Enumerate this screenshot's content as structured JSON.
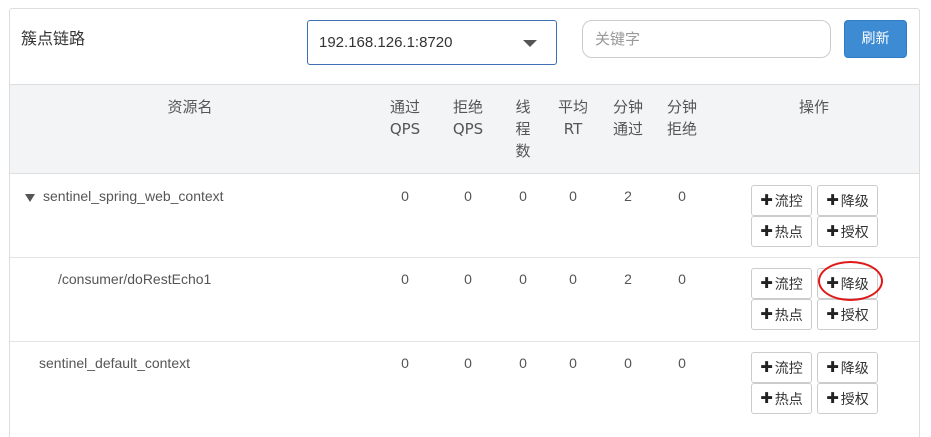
{
  "header": {
    "title": "簇点链路",
    "machine_select_value": "192.168.126.1:8720",
    "search_placeholder": "关键字",
    "refresh_label": "刷新"
  },
  "columns": {
    "resource": "资源名",
    "pass_qps": "通过\nQPS",
    "block_qps": "拒绝\nQPS",
    "threads": "线\n程\n数",
    "avg_rt": "平均\nRT",
    "pass_min": "分钟\n通过",
    "block_min": "分钟\n拒绝",
    "ops": "操作"
  },
  "rows": [
    {
      "name": "sentinel_spring_web_context",
      "expanded": true,
      "pass_qps": "0",
      "block_qps": "0",
      "threads": "0",
      "avg_rt": "0",
      "pass_min": "2",
      "block_min": "0"
    },
    {
      "name": "/consumer/doRestEcho1",
      "pass_qps": "0",
      "block_qps": "0",
      "threads": "0",
      "avg_rt": "0",
      "pass_min": "2",
      "block_min": "0"
    },
    {
      "name": "sentinel_default_context",
      "pass_qps": "0",
      "block_qps": "0",
      "threads": "0",
      "avg_rt": "0",
      "pass_min": "0",
      "block_min": "0"
    }
  ],
  "actions": {
    "plus": "✚",
    "flow": "流控",
    "degrade": "降级",
    "hot": "热点",
    "auth": "授权"
  },
  "colors": {
    "primary": "#3d8bd3",
    "highlight_circle": "#e01818",
    "header_bg": "#f2f4f6"
  }
}
